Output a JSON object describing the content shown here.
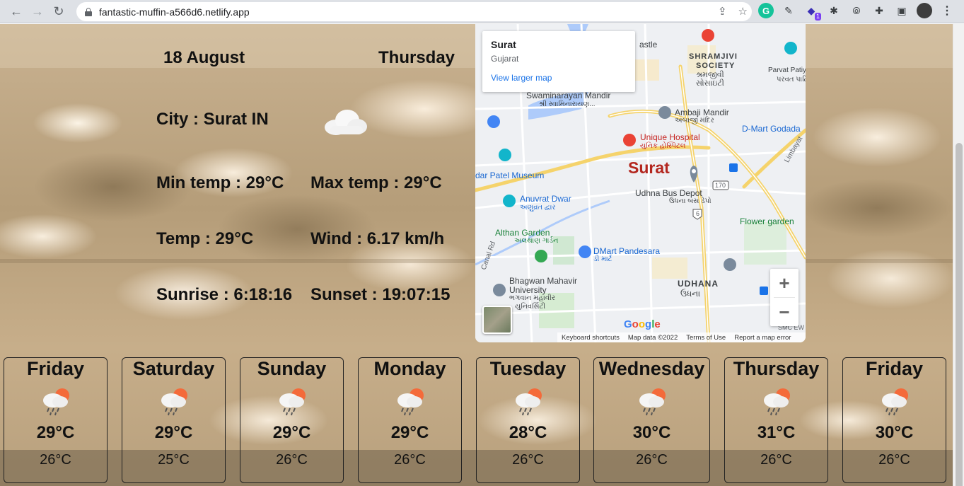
{
  "browser": {
    "url": "fantastic-muffin-a566d6.netlify.app",
    "extensions": [
      {
        "name": "grammarly-icon",
        "glyph": "G"
      },
      {
        "name": "eyedropper-icon",
        "glyph": "✎"
      },
      {
        "name": "extension-badge-icon",
        "glyph": "◆"
      },
      {
        "name": "bug-icon",
        "glyph": "✱"
      },
      {
        "name": "code-icon",
        "glyph": "⦾"
      },
      {
        "name": "puzzle-icon",
        "glyph": "✚"
      },
      {
        "name": "sidebar-icon",
        "glyph": "▣"
      }
    ],
    "badge": "1"
  },
  "current": {
    "date": "18 August",
    "day": "Thursday",
    "city": "City : Surat IN",
    "min_temp": "Min temp : 29°C",
    "max_temp": "Max temp : 29°C",
    "temp": "Temp : 29°C",
    "wind": "Wind : 6.17 km/h",
    "sunrise": "Sunrise : 6:18:16",
    "sunset": "Sunset : 19:07:15",
    "icon": "cloud-icon"
  },
  "map": {
    "place": "Surat",
    "region": "Gujarat",
    "link": "View larger map",
    "city_label": "Surat",
    "zoom_in": "+",
    "zoom_out": "−",
    "logo": "Google",
    "footer": [
      "Keyboard shortcuts",
      "Map data ©2022",
      "Terms of Use",
      "Report a map error"
    ],
    "labels": {
      "castle": "astle",
      "shramjivi_en": "SHRAMJIVI",
      "shramjivi_en2": "SOCIETY",
      "shramjivi_gu": "શ્રમજીવી",
      "shramjivi_gu2": "સોસાઇટી",
      "parvat": "Parvat Patiya",
      "parvat_gu": "પરવત પાટિયા",
      "swaminarayan": "Swaminarayan Mandir",
      "swaminarayan_gu": "શ્રી સ્વામિનારાયણ...",
      "ambaji": "Ambaji Mandir",
      "ambaji_gu": "અંબાજી મંદિર",
      "dmart_godadara": "D-Mart Godada",
      "unique": "Unique Hospital",
      "unique_gu": "યુનિક હોસ્પિટલ",
      "limbayat": "Limbayat",
      "sardar": "dar Patel Museum",
      "anuvrat": "Anuvrat Dwar",
      "anuvrat_gu": "અણુવ્રત દ્વાર",
      "udhna_depot": "Udhna Bus Depot",
      "udhna_depot_gu": "ઉધના બસ ડેપો",
      "flower": "Flower garden",
      "althan": "Althan Garden",
      "althan_gu": "અલથાણ ગાર્ડન",
      "canal": "Canal Rd",
      "dmart_pandesara": "DMart Pandesara",
      "dmart_pandesara_gu": "ડી માર્ટ",
      "bhagwan": "Bhagwan Mahavir",
      "bhagwan2": "University",
      "bhagwan_gu": "ભગવાન મહાવીર",
      "bhagwan_gu2": "યુનિવર્સિટી",
      "udhana": "UDHANA",
      "udhana_gu": "ઉધના",
      "road_170": "170",
      "road_6": "6",
      "smc": "SMC EW"
    }
  },
  "forecast": [
    {
      "day": "Friday",
      "max": "29°C",
      "min": "26°C"
    },
    {
      "day": "Saturday",
      "max": "29°C",
      "min": "25°C"
    },
    {
      "day": "Sunday",
      "max": "29°C",
      "min": "26°C"
    },
    {
      "day": "Monday",
      "max": "29°C",
      "min": "26°C"
    },
    {
      "day": "Tuesday",
      "max": "28°C",
      "min": "26°C"
    },
    {
      "day": "Wednesday",
      "max": "30°C",
      "min": "26°C"
    },
    {
      "day": "Thursday",
      "max": "31°C",
      "min": "26°C"
    },
    {
      "day": "Friday",
      "max": "30°C",
      "min": "26°C"
    }
  ],
  "forecast_icon": "sun-rain-cloud-icon",
  "colors": {
    "map_accent": "#1a73e8",
    "city_red": "#b3261e",
    "chrome_bg": "#dee1e6"
  }
}
